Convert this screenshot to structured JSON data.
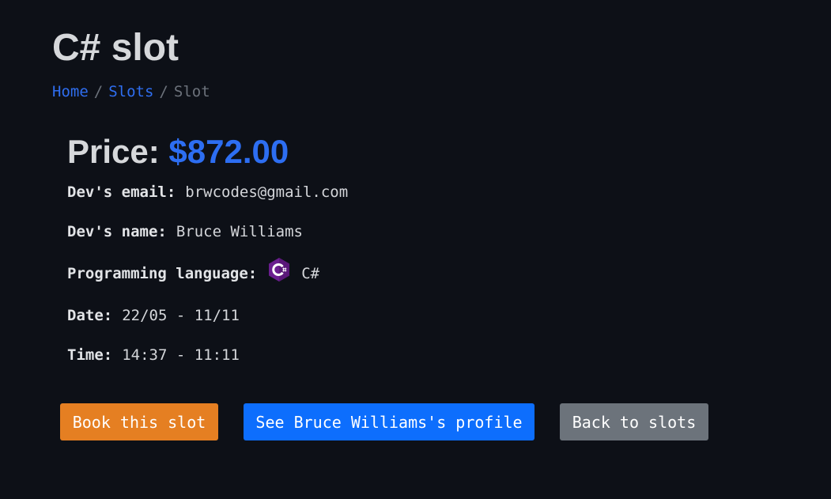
{
  "page": {
    "title": "C# slot"
  },
  "breadcrumb": {
    "items": [
      {
        "label": "Home"
      },
      {
        "label": "Slots"
      },
      {
        "label": "Slot"
      }
    ],
    "separator": "/"
  },
  "price": {
    "label": "Price:",
    "value": "$872.00"
  },
  "details": {
    "email": {
      "label": "Dev's email:",
      "value": "brwcodes@gmail.com"
    },
    "name": {
      "label": "Dev's name:",
      "value": "Bruce Williams"
    },
    "language": {
      "label": "Programming language:",
      "value": "C#",
      "icon": "csharp-logo-icon"
    },
    "date": {
      "label": "Date:",
      "value": "22/05 - 11/11"
    },
    "time": {
      "label": "Time:",
      "value": "14:37 - 11:11"
    }
  },
  "actions": {
    "book_label": "Book this slot",
    "profile_label": "See Bruce Williams's profile",
    "back_label": "Back to slots"
  },
  "colors": {
    "background": "#0d1017",
    "link": "#2f6ef0",
    "price": "#2d6ef2",
    "book_button": "#e57f22",
    "profile_button": "#0d6efd",
    "back_button": "#6c737b",
    "csharp_icon": "#6a1e8f"
  }
}
